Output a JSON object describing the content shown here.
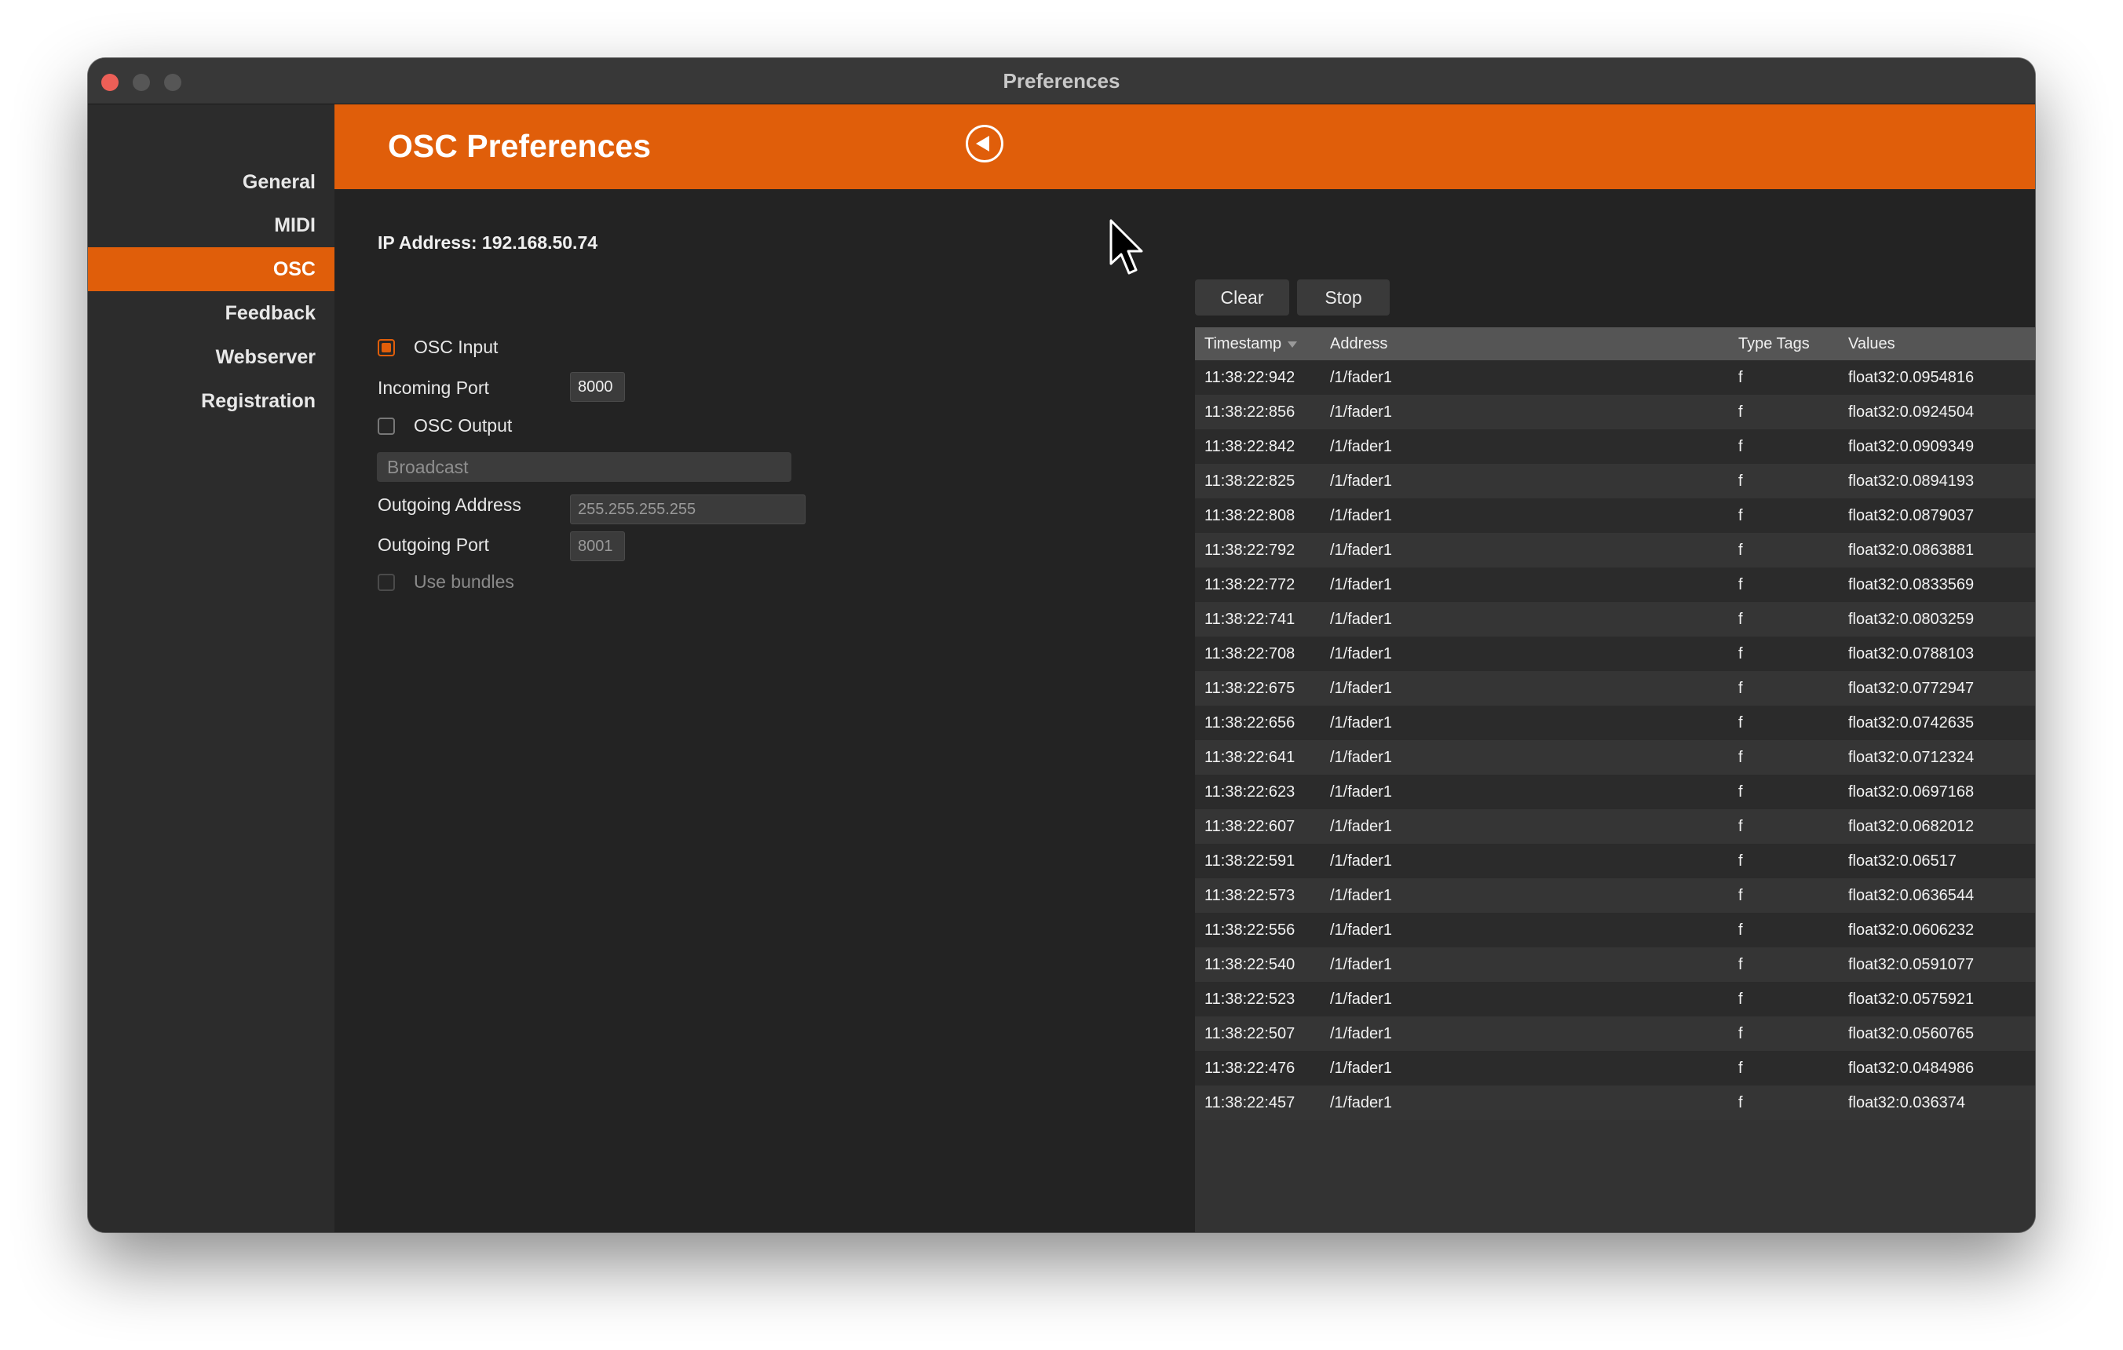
{
  "window": {
    "title": "Preferences"
  },
  "sidebar": {
    "items": [
      {
        "label": "General"
      },
      {
        "label": "MIDI"
      },
      {
        "label": "OSC"
      },
      {
        "label": "Feedback"
      },
      {
        "label": "Webserver"
      },
      {
        "label": "Registration"
      }
    ],
    "active": "OSC"
  },
  "header": {
    "title": "OSC Preferences"
  },
  "osc": {
    "ip_label": "IP Address: 192.168.50.74",
    "osc_input_label": "OSC Input",
    "osc_input_checked": true,
    "incoming_port_label": "Incoming Port",
    "incoming_port_value": "8000",
    "osc_output_label": "OSC Output",
    "osc_output_checked": false,
    "broadcast_label": "Broadcast",
    "outgoing_address_label": "Outgoing Address",
    "outgoing_address_value": "255.255.255.255",
    "outgoing_port_label": "Outgoing Port",
    "outgoing_port_value": "8001",
    "use_bundles_label": "Use bundles",
    "use_bundles_checked": false
  },
  "monitor": {
    "clear_label": "Clear",
    "stop_label": "Stop",
    "columns": [
      "Timestamp",
      "Address",
      "Type Tags",
      "Values"
    ],
    "rows": [
      [
        "11:38:22:942",
        "/1/fader1",
        "f",
        "float32:0.0954816"
      ],
      [
        "11:38:22:856",
        "/1/fader1",
        "f",
        "float32:0.0924504"
      ],
      [
        "11:38:22:842",
        "/1/fader1",
        "f",
        "float32:0.0909349"
      ],
      [
        "11:38:22:825",
        "/1/fader1",
        "f",
        "float32:0.0894193"
      ],
      [
        "11:38:22:808",
        "/1/fader1",
        "f",
        "float32:0.0879037"
      ],
      [
        "11:38:22:792",
        "/1/fader1",
        "f",
        "float32:0.0863881"
      ],
      [
        "11:38:22:772",
        "/1/fader1",
        "f",
        "float32:0.0833569"
      ],
      [
        "11:38:22:741",
        "/1/fader1",
        "f",
        "float32:0.0803259"
      ],
      [
        "11:38:22:708",
        "/1/fader1",
        "f",
        "float32:0.0788103"
      ],
      [
        "11:38:22:675",
        "/1/fader1",
        "f",
        "float32:0.0772947"
      ],
      [
        "11:38:22:656",
        "/1/fader1",
        "f",
        "float32:0.0742635"
      ],
      [
        "11:38:22:641",
        "/1/fader1",
        "f",
        "float32:0.0712324"
      ],
      [
        "11:38:22:623",
        "/1/fader1",
        "f",
        "float32:0.0697168"
      ],
      [
        "11:38:22:607",
        "/1/fader1",
        "f",
        "float32:0.0682012"
      ],
      [
        "11:38:22:591",
        "/1/fader1",
        "f",
        "float32:0.06517"
      ],
      [
        "11:38:22:573",
        "/1/fader1",
        "f",
        "float32:0.0636544"
      ],
      [
        "11:38:22:556",
        "/1/fader1",
        "f",
        "float32:0.0606232"
      ],
      [
        "11:38:22:540",
        "/1/fader1",
        "f",
        "float32:0.0591077"
      ],
      [
        "11:38:22:523",
        "/1/fader1",
        "f",
        "float32:0.0575921"
      ],
      [
        "11:38:22:507",
        "/1/fader1",
        "f",
        "float32:0.0560765"
      ],
      [
        "11:38:22:476",
        "/1/fader1",
        "f",
        "float32:0.0484986"
      ],
      [
        "11:38:22:457",
        "/1/fader1",
        "f",
        "float32:0.036374"
      ]
    ]
  },
  "colors": {
    "accent": "#e05e0a",
    "window_bg": "#232323",
    "sidebar_bg": "#2c2c2c",
    "table_header": "#555555"
  },
  "icons": {
    "back": "back-arrow-icon",
    "cursor": "mouse-pointer-icon"
  }
}
